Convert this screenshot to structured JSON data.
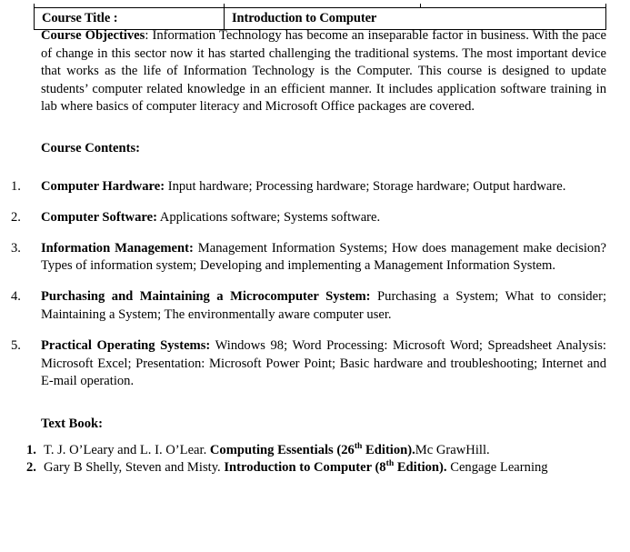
{
  "header_table": {
    "label": "Course Title :",
    "value": "Introduction to Computer"
  },
  "objectives": {
    "label": "Course Objectives",
    "separator": ": ",
    "text": "Information Technology has become an inseparable factor in business. With the pace of change in this sector now it has started challenging the traditional systems. The most important device that works as the life of Information Technology is the Computer. This course is designed to update students’ computer related knowledge in an efficient manner.  It includes application software training in lab where basics of computer literacy and Microsoft Office packages are covered."
  },
  "contents": {
    "heading": "Course Contents:",
    "items": [
      {
        "number": "1.",
        "title": "Computer Hardware:",
        "text": " Input hardware; Processing hardware; Storage hardware; Output hardware."
      },
      {
        "number": "2.",
        "title": "Computer Software:",
        "text": " Applications software; Systems software."
      },
      {
        "number": "3.",
        "title": "Information Management:",
        "text": " Management Information Systems; How does management make decision? Types of information system; Developing and implementing a Management Information System."
      },
      {
        "number": "4.",
        "title": "Purchasing and Maintaining a Microcomputer System:",
        "text": " Purchasing a System; What to consider; Maintaining a System; The environmentally aware computer user."
      },
      {
        "number": "5.",
        "title": "Practical Operating Systems:",
        "text": " Windows 98; Word Processing: Microsoft Word; Spreadsheet Analysis: Microsoft Excel; Presentation: Microsoft Power Point; Basic hardware and troubleshooting; Internet and E-mail operation."
      }
    ]
  },
  "textbook": {
    "heading": "Text Book:",
    "items": [
      {
        "number": "1.",
        "authors": " T. J. O’Leary and L. I. O’Lear. ",
        "title_pre": "Computing Essentials (26",
        "superscript": "th",
        "title_post": " Edition).",
        "publisher": "Mc GrawHill."
      },
      {
        "number": "2.",
        "authors": " Gary B Shelly, Steven and Misty. ",
        "title_pre": "Introduction to Computer (8",
        "superscript": "th",
        "title_post": " Edition).",
        "publisher": " Cengage Learning"
      }
    ]
  }
}
